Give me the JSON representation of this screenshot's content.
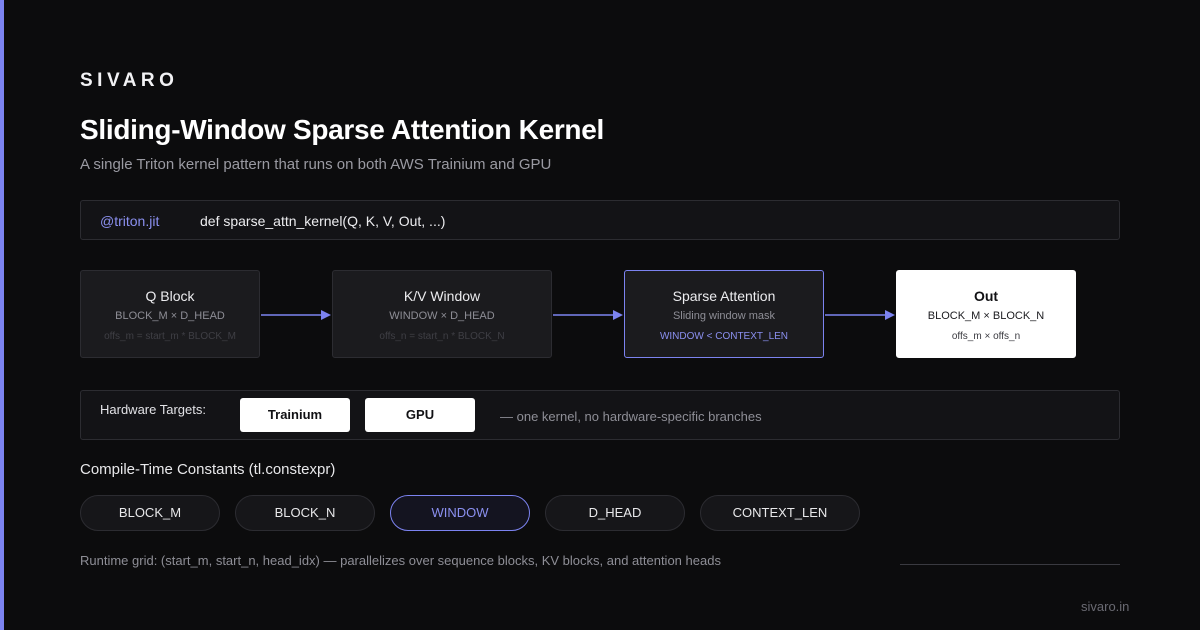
{
  "brand": "SIVARO",
  "title": "Sliding-Window Sparse Attention Kernel",
  "subtitle": "A single Triton kernel pattern that runs on both AWS Trainium and GPU",
  "code": {
    "decorator": "@triton.jit",
    "signature": "def sparse_attn_kernel(Q, K, V, Out, ...)"
  },
  "pipeline": [
    {
      "title": "Q Block",
      "line1": "BLOCK_M × D_HEAD",
      "line2": "offs_m = start_m * BLOCK_M"
    },
    {
      "title": "K/V Window",
      "line1": "WINDOW × D_HEAD",
      "line2": "offs_n = start_n * BLOCK_N"
    },
    {
      "title": "Sparse Attention",
      "line1": "Sliding window mask",
      "line2": "WINDOW < CONTEXT_LEN"
    },
    {
      "title": "Out",
      "line1": "BLOCK_M × BLOCK_N",
      "line2": "offs_m × offs_n"
    }
  ],
  "hardware": {
    "label": "Hardware Targets:",
    "targets": [
      "Trainium",
      "GPU"
    ],
    "note": "— one kernel, no hardware-specific branches"
  },
  "constants": {
    "heading": "Compile-Time Constants (tl.constexpr)",
    "items": [
      "BLOCK_M",
      "BLOCK_N",
      "WINDOW",
      "D_HEAD",
      "CONTEXT_LEN"
    ],
    "highlighted": "WINDOW"
  },
  "runtime": "Runtime grid: (start_m, start_n, head_idx) — parallelizes over sequence blocks, KV blocks, and attention heads",
  "footer_url": "sivaro.in",
  "colors": {
    "background": "#0c0c0d",
    "accent": "#7c83f0",
    "panel": "#1b1b1e",
    "border": "#2c2c31",
    "text_muted": "#8e8e96"
  }
}
